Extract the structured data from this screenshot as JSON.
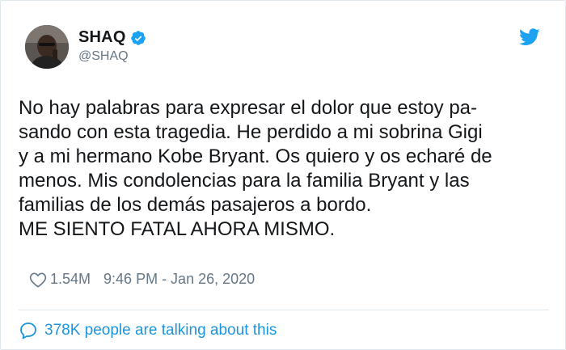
{
  "user": {
    "display_name": "SHAQ",
    "handle": "@SHAQ",
    "verified": true
  },
  "tweet": {
    "lines": [
      "No hay palabras para expresar el dolor que estoy pa-",
      "sando con esta tragedia. He perdido a mi sobrina Gigi",
      "y a mi hermano Kobe Bryant. Os quiero y os echaré de",
      "menos. Mis condolencias para la familia Bryant y las",
      "familias de los demás pasajeros a bordo.",
      "ME SIENTO FATAL AHORA MISMO."
    ],
    "likes": "1.54M",
    "timestamp": "9:46 PM - Jan 26, 2020"
  },
  "footer": {
    "talking_label": "378K people are talking about this"
  },
  "icons": {
    "verified": "verified-badge-icon",
    "logo": "twitter-bird-icon",
    "like": "heart-icon",
    "talking": "speech-bubble-icon"
  },
  "colors": {
    "accent": "#1da1f2",
    "link": "#1b95e0",
    "secondary_text": "#657786",
    "primary_text": "#14171a",
    "border": "#e1e8ed"
  }
}
